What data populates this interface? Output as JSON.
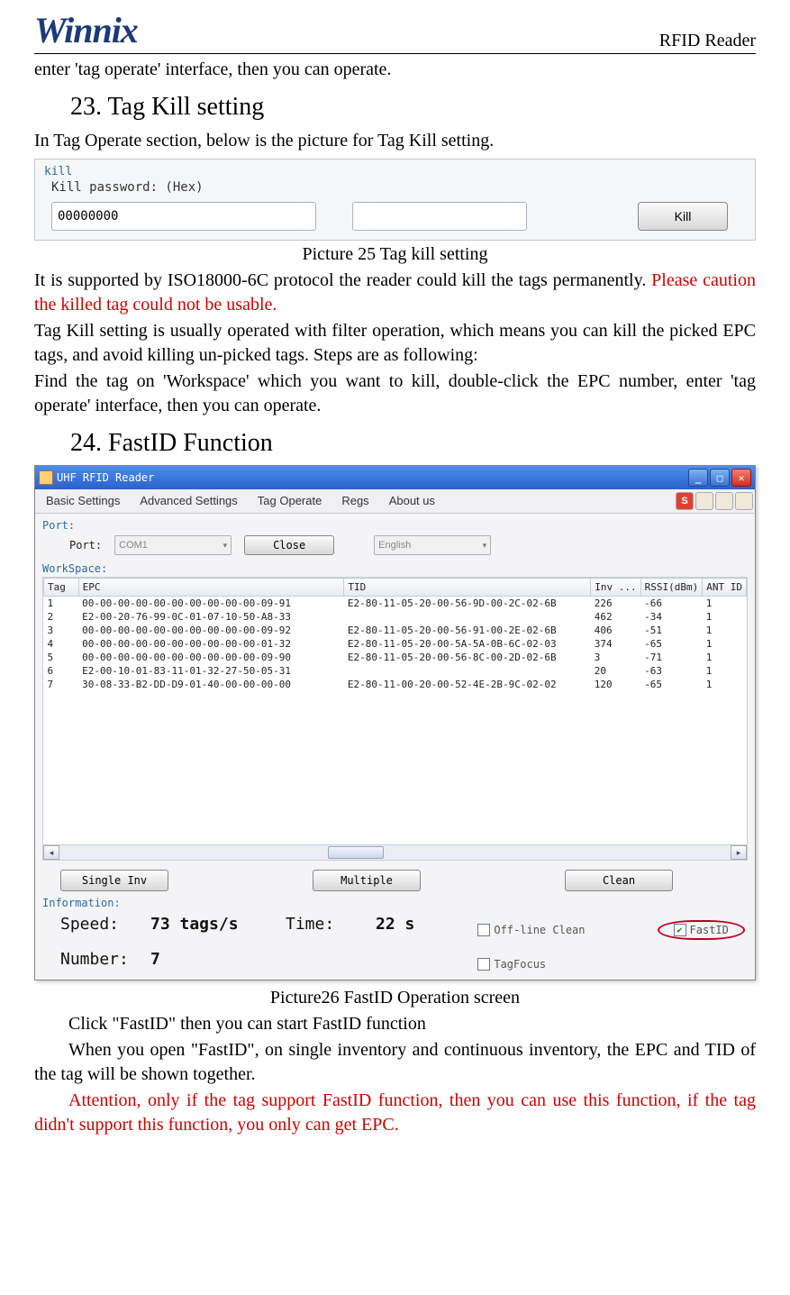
{
  "header": {
    "brand": "Winnix",
    "right": "RFID Reader"
  },
  "intro_line": "enter 'tag operate' interface, then you can operate.",
  "sec23": {
    "heading": "23.  Tag Kill setting",
    "lead": "In Tag Operate section, below is the picture for Tag Kill setting.",
    "panel": {
      "group": "kill",
      "label": "Kill password: (Hex)",
      "value": "00000000",
      "button": "Kill"
    },
    "caption": "Picture 25 Tag kill setting",
    "p1a": "It is supported by ISO18000-6C protocol the reader could kill the tags permanently. ",
    "p1b": "Please caution the killed tag could not be usable.",
    "p2": "Tag Kill setting is usually operated with filter operation, which means you can kill the picked EPC tags, and avoid killing un-picked tags. Steps are as following:",
    "p3": "Find the tag on 'Workspace' which you want to kill, double-click the EPC number, enter 'tag operate' interface, then you can operate."
  },
  "sec24": {
    "heading": "24.  FastID Function",
    "app": {
      "title": "UHF RFID Reader",
      "menus": [
        "Basic Settings",
        "Advanced Settings",
        "Tag Operate",
        "Regs",
        "About us"
      ],
      "port_group": "Port:",
      "port_label": "Port:",
      "port_value": "COM1",
      "close_btn": "Close",
      "lang_value": "English",
      "workspace_label": "WorkSpace:",
      "columns": [
        "Tag",
        "EPC",
        "TID",
        "Inv ...",
        "RSSI(dBm)",
        "ANT ID"
      ],
      "rows": [
        {
          "tag": "1",
          "epc": "00-00-00-00-00-00-00-00-00-00-09-91",
          "tid": "E2-80-11-05-20-00-56-9D-00-2C-02-6B",
          "inv": "226",
          "rssi": "-66",
          "ant": "1"
        },
        {
          "tag": "2",
          "epc": "E2-00-20-76-99-0C-01-07-10-50-A8-33",
          "tid": "",
          "inv": "462",
          "rssi": "-34",
          "ant": "1"
        },
        {
          "tag": "3",
          "epc": "00-00-00-00-00-00-00-00-00-00-09-92",
          "tid": "E2-80-11-05-20-00-56-91-00-2E-02-6B",
          "inv": "406",
          "rssi": "-51",
          "ant": "1"
        },
        {
          "tag": "4",
          "epc": "00-00-00-00-00-00-00-00-00-00-01-32",
          "tid": "E2-80-11-05-20-00-5A-5A-0B-6C-02-03",
          "inv": "374",
          "rssi": "-65",
          "ant": "1"
        },
        {
          "tag": "5",
          "epc": "00-00-00-00-00-00-00-00-00-00-09-90",
          "tid": "E2-80-11-05-20-00-56-8C-00-2D-02-6B",
          "inv": "3",
          "rssi": "-71",
          "ant": "1"
        },
        {
          "tag": "6",
          "epc": "E2-00-10-01-83-11-01-32-27-50-05-31",
          "tid": "",
          "inv": "20",
          "rssi": "-63",
          "ant": "1"
        },
        {
          "tag": "7",
          "epc": "30-08-33-B2-DD-D9-01-40-00-00-00-00",
          "tid": "E2-80-11-00-20-00-52-4E-2B-9C-02-02",
          "inv": "120",
          "rssi": "-65",
          "ant": "1"
        }
      ],
      "buttons": {
        "single": "Single Inv",
        "multiple": "Multiple",
        "clean": "Clean"
      },
      "info_label": "Information:",
      "speed_label": "Speed:",
      "speed_value": "73 tags/s",
      "time_label": "Time:",
      "time_value": "22 s",
      "number_label": "Number:",
      "number_value": "7",
      "chk_offline": "Off-line Clean",
      "chk_fastid": "FastID",
      "chk_tagfocus": "TagFocus"
    },
    "caption": "Picture26 FastID Operation screen",
    "p1": "Click \"FastID\" then you can start FastID function",
    "p2": "When you open  \"FastID\", on single inventory and continuous inventory, the EPC and TID of the tag will be shown together.",
    "p3": "Attention, only if the tag support FastID function, then you can use this function, if the tag didn't support this function, you only can get EPC."
  }
}
